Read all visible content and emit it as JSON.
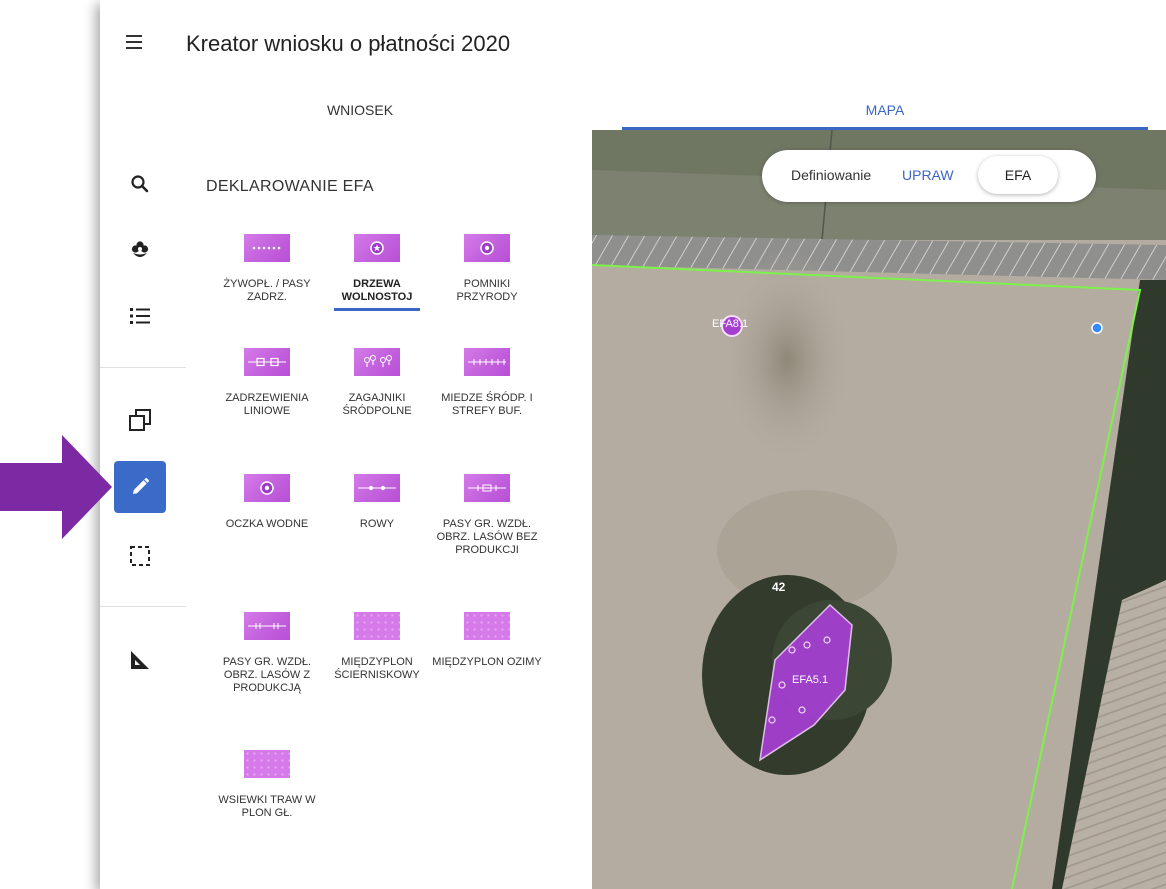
{
  "header": {
    "title": "Kreator wniosku o płatności 2020"
  },
  "tabs": [
    {
      "label": "WNIOSEK"
    },
    {
      "label": "MAPA"
    }
  ],
  "panel": {
    "title": "DEKLAROWANIE EFA",
    "items": [
      {
        "label": "ŻYWOPŁ. / PASY ZADRZ."
      },
      {
        "label": "DRZEWA WOLNOSTOJ"
      },
      {
        "label": "POMNIKI PRZYRODY"
      },
      {
        "label": "ZADRZEWIENIA LINIOWE"
      },
      {
        "label": "ZAGAJNIKI ŚRÓDPOLNE"
      },
      {
        "label": "MIEDZE ŚRÓDP. I STREFY BUF."
      },
      {
        "label": "OCZKA WODNE"
      },
      {
        "label": "ROWY"
      },
      {
        "label": "PASY GR. WZDŁ. OBRZ. LASÓW BEZ PRODUKCJI"
      },
      {
        "label": "PASY GR. WZDŁ. OBRZ. LASÓW Z PRODUKCJĄ"
      },
      {
        "label": "MIĘDZYPLON ŚCIERNISKOWY"
      },
      {
        "label": "MIĘDZYPLON OZIMY"
      },
      {
        "label": "WSIEWKI TRAW W PLON GŁ."
      }
    ]
  },
  "map": {
    "toggle": {
      "prefix": "Definiowanie",
      "upraw": "UPRAW",
      "efa": "EFA"
    },
    "labels": {
      "parcel": "42",
      "marker": "EFA8.1",
      "polygon": "EFA5.1"
    }
  },
  "colors": {
    "accent": "#3a66c4",
    "efa_purple": "#a43fd0",
    "parcel_border": "#7cf24a",
    "pointer_arrow": "#7b2aa3"
  }
}
